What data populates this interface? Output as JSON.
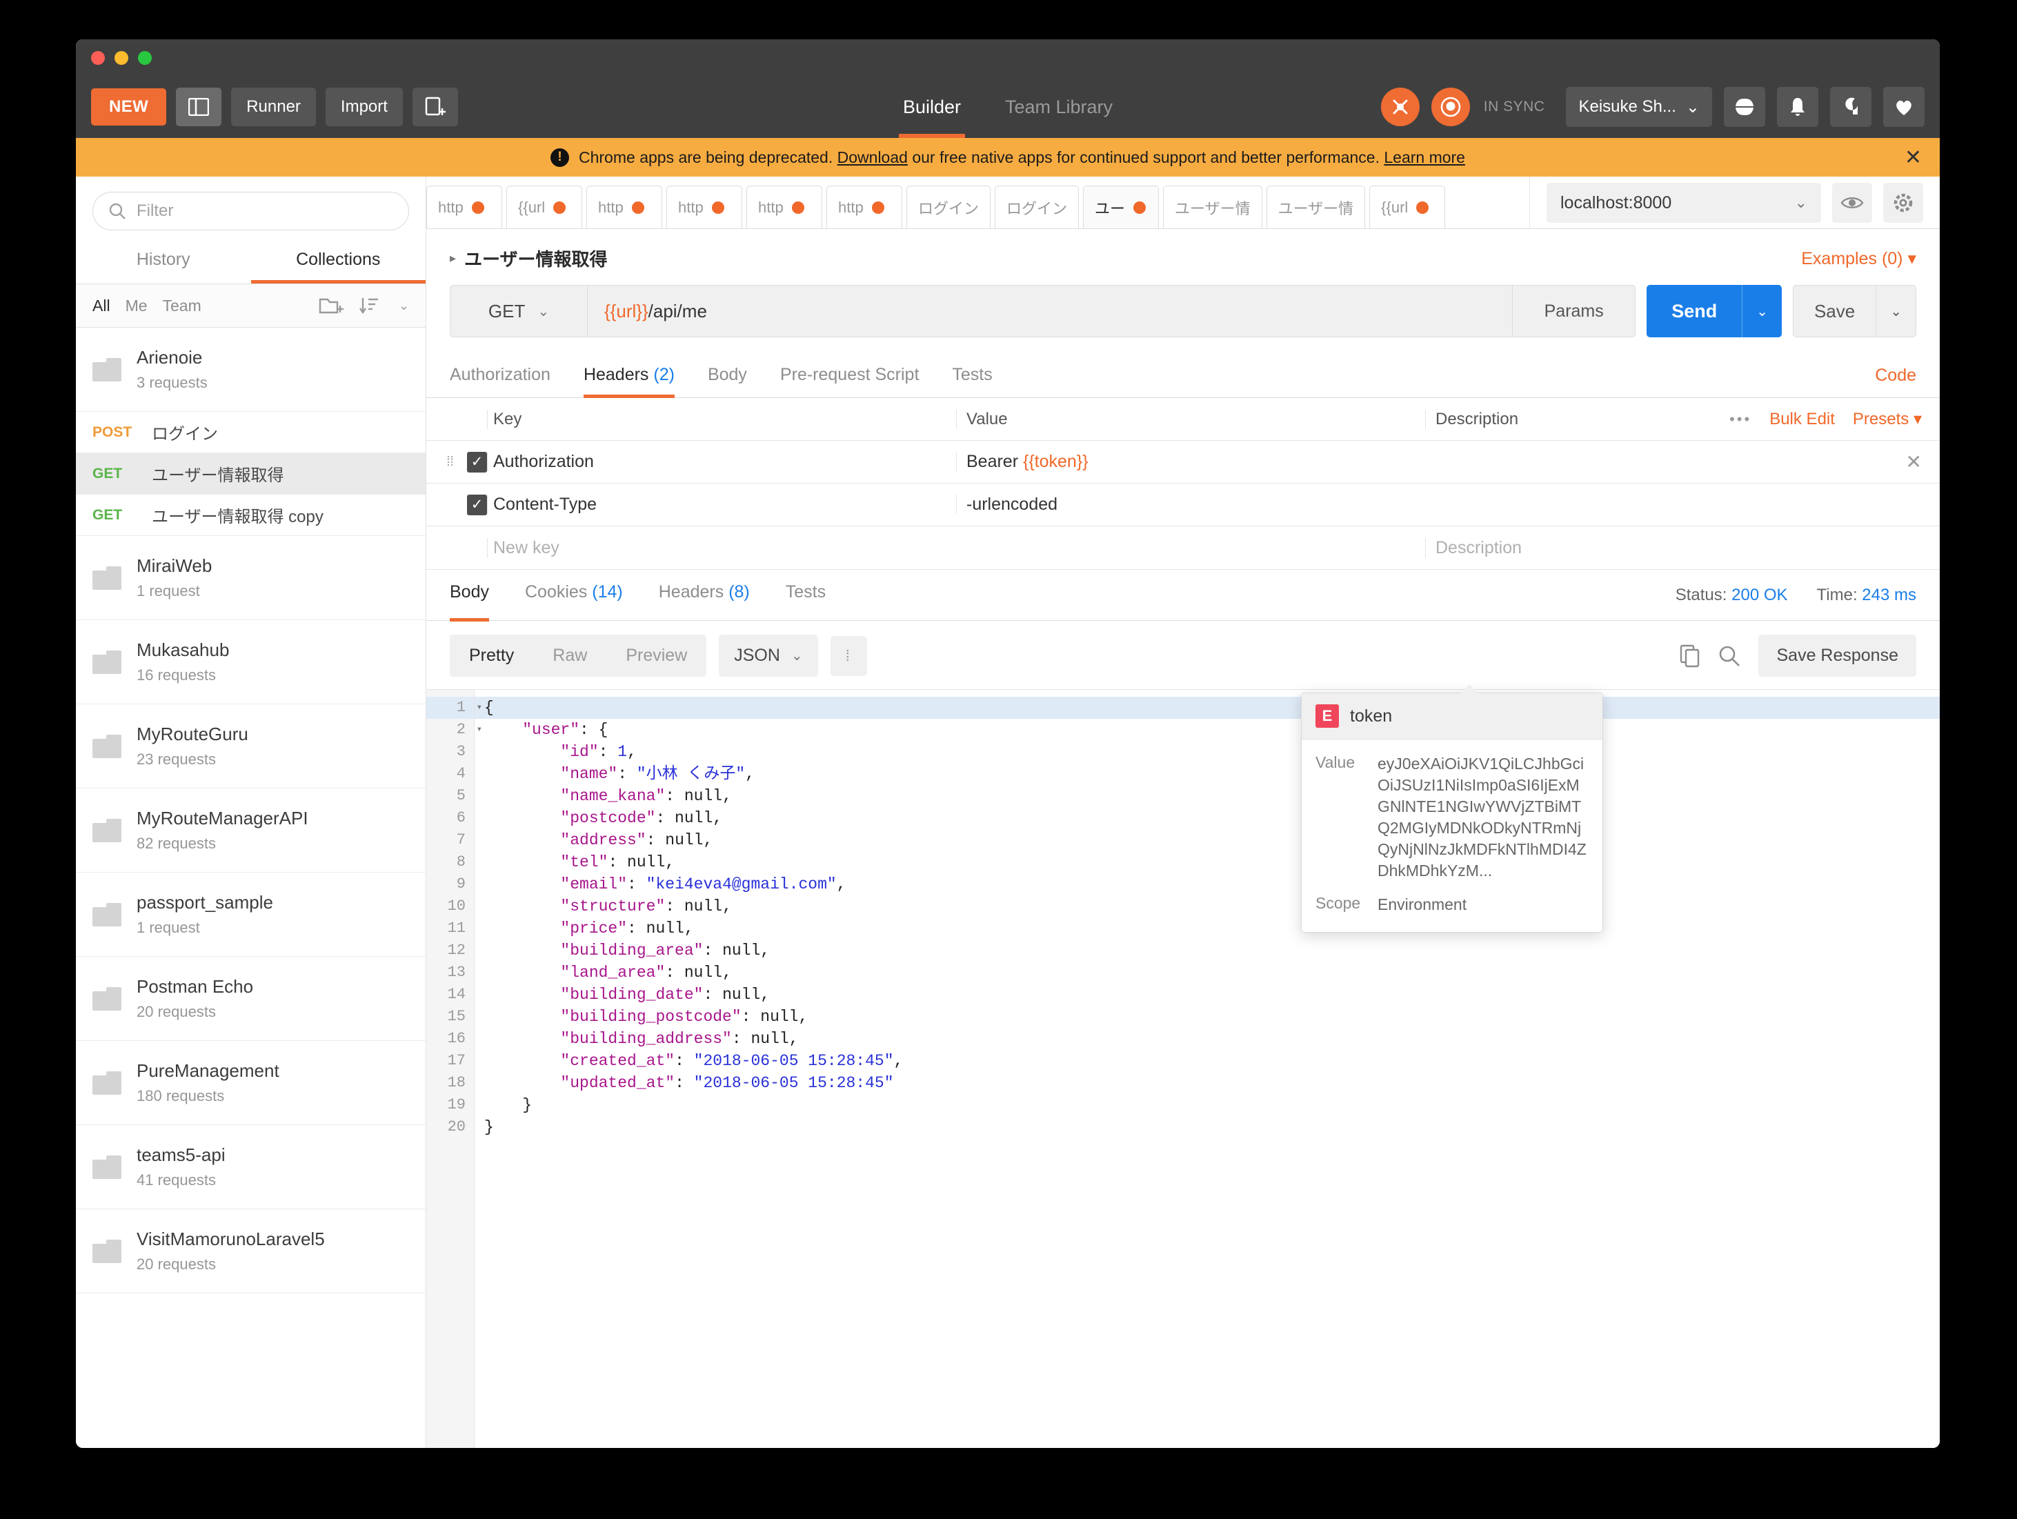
{
  "toolbar": {
    "new_label": "NEW",
    "sidebar_toggle_label": "",
    "runner_label": "Runner",
    "import_label": "Import",
    "new_tab_label": "",
    "modes": [
      {
        "label": "Builder",
        "active": true
      },
      {
        "label": "Team Library",
        "active": false
      }
    ],
    "sync_status": "IN SYNC",
    "user_name": "Keisuke Sh...",
    "icons": [
      "rocket-sync-icon",
      "orbit-sync-icon",
      "globe-icon",
      "bell-icon",
      "wrench-icon",
      "heart-icon"
    ]
  },
  "banner": {
    "text_before": "Chrome apps are being deprecated.",
    "link1": "Download",
    "text_middle": "our free native apps for continued support and better performance.",
    "link2": "Learn more",
    "close": "✕",
    "bg_color": "#f7ac42"
  },
  "sidebar": {
    "filter_placeholder": "Filter",
    "tabs": [
      {
        "label": "History",
        "active": false
      },
      {
        "label": "Collections",
        "active": true
      }
    ],
    "scopes": [
      {
        "label": "All",
        "active": true
      },
      {
        "label": "Me",
        "active": false
      },
      {
        "label": "Team",
        "active": false
      }
    ],
    "collections": [
      {
        "name": "Arienoie",
        "requests": "3 requests"
      },
      {
        "name": "MiraiWeb",
        "requests": "1 request"
      },
      {
        "name": "Mukasahub",
        "requests": "16 requests"
      },
      {
        "name": "MyRouteGuru",
        "requests": "23 requests"
      },
      {
        "name": "MyRouteManagerAPI",
        "requests": "82 requests"
      },
      {
        "name": "passport_sample",
        "requests": "1 request"
      },
      {
        "name": "Postman Echo",
        "requests": "20 requests"
      },
      {
        "name": "PureManagement",
        "requests": "180 requests"
      },
      {
        "name": "teams5-api",
        "requests": "41 requests"
      },
      {
        "name": "VisitMamorunoLaravel5",
        "requests": "20 requests"
      }
    ],
    "expanded_requests": [
      {
        "method": "POST",
        "name": "ログイン",
        "selected": false
      },
      {
        "method": "GET",
        "name": "ユーザー情報取得",
        "selected": true
      },
      {
        "method": "GET",
        "name": "ユーザー情報取得 copy",
        "selected": false
      }
    ]
  },
  "request_tabs": [
    {
      "label": "http",
      "unsaved": true,
      "active": false
    },
    {
      "label": "{{url",
      "unsaved": true,
      "active": false
    },
    {
      "label": "http",
      "unsaved": true,
      "active": false
    },
    {
      "label": "http",
      "unsaved": true,
      "active": false
    },
    {
      "label": "http",
      "unsaved": true,
      "active": false
    },
    {
      "label": "http",
      "unsaved": true,
      "active": false
    },
    {
      "label": "ログイン",
      "unsaved": false,
      "active": false
    },
    {
      "label": "ログイン",
      "unsaved": false,
      "active": false
    },
    {
      "label": "ユー",
      "unsaved": true,
      "active": true
    },
    {
      "label": "ユーザー情",
      "unsaved": false,
      "active": false
    },
    {
      "label": "ユーザー情",
      "unsaved": false,
      "active": false
    },
    {
      "label": "{{url",
      "unsaved": true,
      "active": false
    }
  ],
  "environment": {
    "selected": "localhost:8000",
    "eye_icon": "eye-icon",
    "gear_icon": "gear-icon"
  },
  "request": {
    "name": "ユーザー情報取得",
    "examples_label": "Examples (0)",
    "method": "GET",
    "url_variable": "{{url}}",
    "url_path": "/api/me",
    "params_label": "Params",
    "send_label": "Send",
    "save_label": "Save",
    "tabs": [
      {
        "label": "Authorization",
        "count": "",
        "active": false
      },
      {
        "label": "Headers",
        "count": "(2)",
        "active": true
      },
      {
        "label": "Body",
        "count": "",
        "active": false
      },
      {
        "label": "Pre-request Script",
        "count": "",
        "active": false
      },
      {
        "label": "Tests",
        "count": "",
        "active": false
      }
    ],
    "code_link": "Code"
  },
  "headers_table": {
    "columns": [
      "Key",
      "Value",
      "Description"
    ],
    "bulk_edit_label": "Bulk Edit",
    "presets_label": "Presets ▾",
    "rows": [
      {
        "checked": true,
        "key": "Authorization",
        "value_prefix": "Bearer ",
        "value_var": "{{token}}",
        "description": ""
      },
      {
        "checked": true,
        "key": "Content-Type",
        "value_prefix": "",
        "value_var": "-urlencoded",
        "description": ""
      }
    ],
    "new_row": {
      "key_placeholder": "New key",
      "desc_placeholder": "Description"
    }
  },
  "variable_popover": {
    "badge": "E",
    "name": "token",
    "value_label": "Value",
    "value": "eyJ0eXAiOiJKV1QiLCJhbGciOiJSUzI1NiIsImp0aSI6IjExMGNlNTE1NGIwYWVjZTBiMTQ2MGIyMDNkODkyNTRmNjQyNjNlNzJkMDFkNTlhMDI4ZDhkMDhkYzM...",
    "scope_label": "Scope",
    "scope": "Environment"
  },
  "response": {
    "tabs": [
      {
        "label": "Body",
        "count": "",
        "active": true
      },
      {
        "label": "Cookies",
        "count": "(14)",
        "active": false
      },
      {
        "label": "Headers",
        "count": "(8)",
        "active": false
      },
      {
        "label": "Tests",
        "count": "",
        "active": false
      }
    ],
    "status_label": "Status:",
    "status_value": "200 OK",
    "time_label": "Time:",
    "time_value": "243 ms",
    "view_modes": [
      {
        "label": "Pretty",
        "active": true
      },
      {
        "label": "Raw",
        "active": false
      },
      {
        "label": "Preview",
        "active": false
      }
    ],
    "format": "JSON",
    "copy_icon": "copy-icon",
    "search_icon": "search-icon",
    "save_response_label": "Save Response",
    "body_lines": [
      {
        "num": "1",
        "fold": true,
        "html": "<span class=\"p\">{</span>"
      },
      {
        "num": "2",
        "fold": true,
        "html": "    <span class=\"k\">\"user\"</span><span class=\"p\">: {</span>"
      },
      {
        "num": "3",
        "fold": false,
        "html": "        <span class=\"k\">\"id\"</span><span class=\"p\">: </span><span class=\"n\">1</span><span class=\"p\">,</span>"
      },
      {
        "num": "4",
        "fold": false,
        "html": "        <span class=\"k\">\"name\"</span><span class=\"p\">: </span><span class=\"s\">\"小林 くみ子\"</span><span class=\"p\">,</span>"
      },
      {
        "num": "5",
        "fold": false,
        "html": "        <span class=\"k\">\"name_kana\"</span><span class=\"p\">: null,</span>"
      },
      {
        "num": "6",
        "fold": false,
        "html": "        <span class=\"k\">\"postcode\"</span><span class=\"p\">: null,</span>"
      },
      {
        "num": "7",
        "fold": false,
        "html": "        <span class=\"k\">\"address\"</span><span class=\"p\">: null,</span>"
      },
      {
        "num": "8",
        "fold": false,
        "html": "        <span class=\"k\">\"tel\"</span><span class=\"p\">: null,</span>"
      },
      {
        "num": "9",
        "fold": false,
        "html": "        <span class=\"k\">\"email\"</span><span class=\"p\">: </span><span class=\"s\">\"kei4eva4@gmail.com\"</span><span class=\"p\">,</span>"
      },
      {
        "num": "10",
        "fold": false,
        "html": "        <span class=\"k\">\"structure\"</span><span class=\"p\">: null,</span>"
      },
      {
        "num": "11",
        "fold": false,
        "html": "        <span class=\"k\">\"price\"</span><span class=\"p\">: null,</span>"
      },
      {
        "num": "12",
        "fold": false,
        "html": "        <span class=\"k\">\"building_area\"</span><span class=\"p\">: null,</span>"
      },
      {
        "num": "13",
        "fold": false,
        "html": "        <span class=\"k\">\"land_area\"</span><span class=\"p\">: null,</span>"
      },
      {
        "num": "14",
        "fold": false,
        "html": "        <span class=\"k\">\"building_date\"</span><span class=\"p\">: null,</span>"
      },
      {
        "num": "15",
        "fold": false,
        "html": "        <span class=\"k\">\"building_postcode\"</span><span class=\"p\">: null,</span>"
      },
      {
        "num": "16",
        "fold": false,
        "html": "        <span class=\"k\">\"building_address\"</span><span class=\"p\">: null,</span>"
      },
      {
        "num": "17",
        "fold": false,
        "html": "        <span class=\"k\">\"created_at\"</span><span class=\"p\">: </span><span class=\"s\">\"2018-06-05 15:28:45\"</span><span class=\"p\">,</span>"
      },
      {
        "num": "18",
        "fold": false,
        "html": "        <span class=\"k\">\"updated_at\"</span><span class=\"p\">: </span><span class=\"s\">\"2018-06-05 15:28:45\"</span>"
      },
      {
        "num": "19",
        "fold": false,
        "html": "    <span class=\"p\">}</span>"
      },
      {
        "num": "20",
        "fold": false,
        "html": "<span class=\"p\">}</span>"
      }
    ]
  }
}
